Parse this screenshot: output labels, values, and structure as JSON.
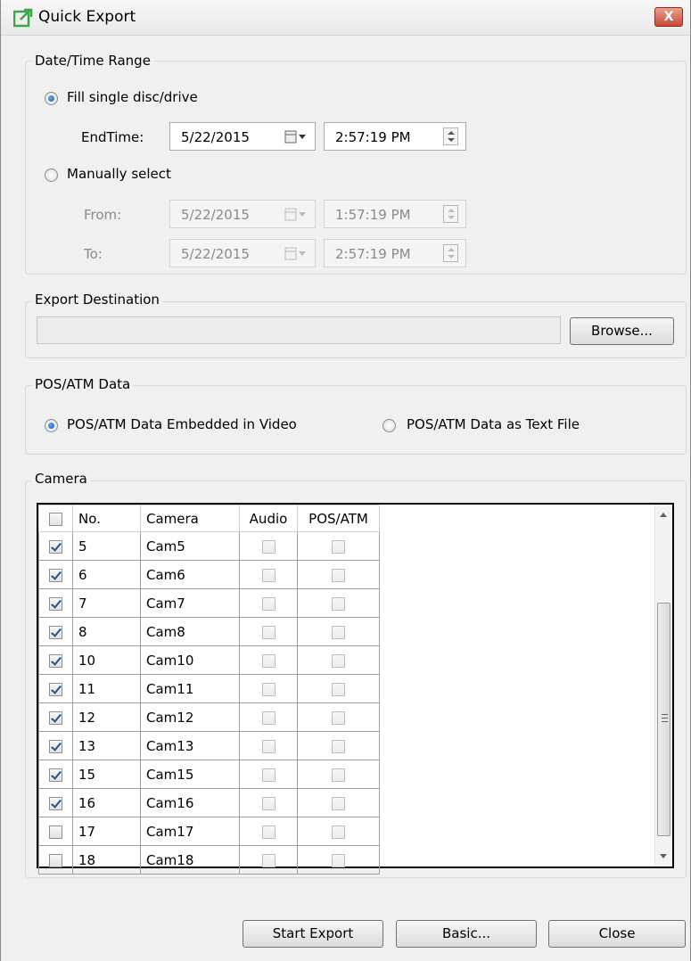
{
  "window": {
    "title": "Quick Export",
    "close_label": "X"
  },
  "date_time_range": {
    "group_label": "Date/Time Range",
    "fill_single_label": "Fill single disc/drive",
    "fill_single_selected": true,
    "endtime_label": "EndTime:",
    "endtime_date": "5/22/2015",
    "endtime_time": "2:57:19 PM",
    "manual_label": "Manually select",
    "manual_selected": false,
    "from_label": "From:",
    "from_date": "5/22/2015",
    "from_time": "1:57:19 PM",
    "to_label": "To:",
    "to_date": "5/22/2015",
    "to_time": "2:57:19 PM"
  },
  "export_destination": {
    "group_label": "Export Destination",
    "path_value": "",
    "browse_label": "Browse..."
  },
  "pos_atm": {
    "group_label": "POS/ATM Data",
    "embedded_label": "POS/ATM Data Embedded in Video",
    "embedded_selected": true,
    "text_file_label": "POS/ATM Data as Text File",
    "text_file_selected": false
  },
  "camera": {
    "group_label": "Camera",
    "columns": {
      "no": "No.",
      "camera": "Camera",
      "audio": "Audio",
      "pos": "POS/ATM"
    },
    "rows": [
      {
        "no": "5",
        "name": "Cam5",
        "checked": true
      },
      {
        "no": "6",
        "name": "Cam6",
        "checked": true
      },
      {
        "no": "7",
        "name": "Cam7",
        "checked": true
      },
      {
        "no": "8",
        "name": "Cam8",
        "checked": true
      },
      {
        "no": "10",
        "name": "Cam10",
        "checked": true
      },
      {
        "no": "11",
        "name": "Cam11",
        "checked": true
      },
      {
        "no": "12",
        "name": "Cam12",
        "checked": true
      },
      {
        "no": "13",
        "name": "Cam13",
        "checked": true
      },
      {
        "no": "15",
        "name": "Cam15",
        "checked": true
      },
      {
        "no": "16",
        "name": "Cam16",
        "checked": true
      },
      {
        "no": "17",
        "name": "Cam17",
        "checked": false
      },
      {
        "no": "18",
        "name": "Cam18",
        "checked": false
      }
    ]
  },
  "buttons": {
    "start_export": "Start Export",
    "basic": "Basic...",
    "close": "Close"
  },
  "colors": {
    "close_button": "#c94a33",
    "app_icon": "#3aa64b",
    "radio_dot": "#1f5fa8"
  },
  "icons": [
    "export-app-icon",
    "calendar-icon",
    "spin-updown-icon",
    "scroll-up-icon",
    "scroll-down-icon"
  ]
}
